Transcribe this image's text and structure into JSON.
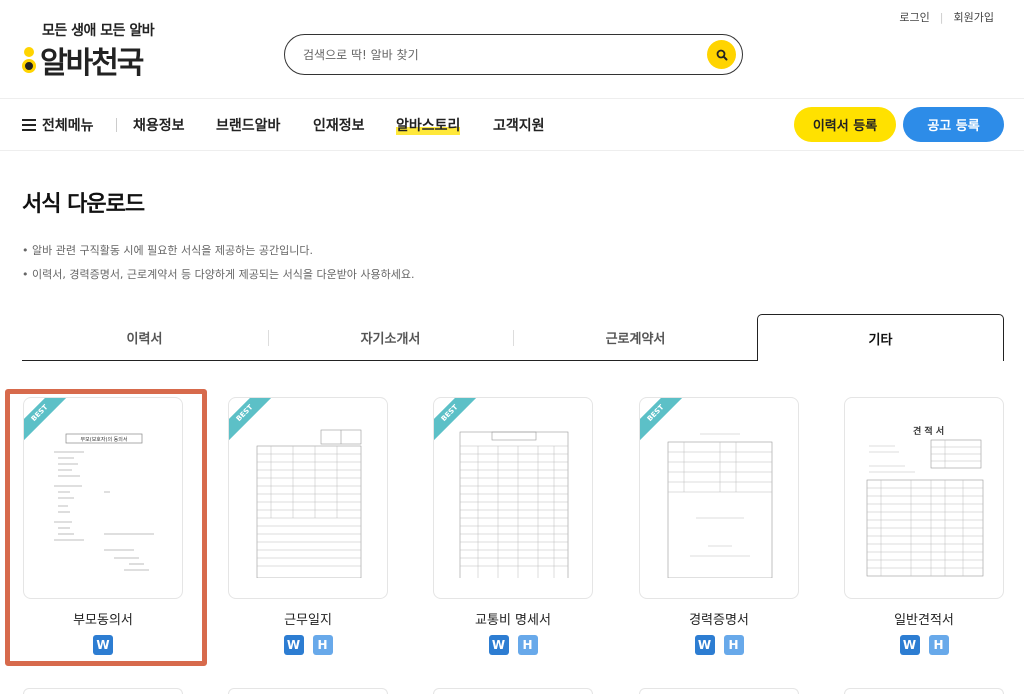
{
  "header": {
    "logo_tagline": "모든 생애 모든 알바",
    "logo_text": "알바천국",
    "search_placeholder": "검색으로 딱! 알바 찾기",
    "login": "로그인",
    "signup": "회원가입"
  },
  "nav": {
    "all_menu": "전체메뉴",
    "items": [
      "채용정보",
      "브랜드알바",
      "인재정보",
      "알바스토리",
      "고객지원"
    ],
    "resume_button": "이력서 등록",
    "post_button": "공고 등록"
  },
  "page": {
    "title": "서식 다운로드",
    "desc1": "• 알바 관련 구직활동 시에 필요한 서식을 제공하는 공간입니다.",
    "desc2": "• 이력서, 경력증명서, 근로계약서 등 다양하게 제공되는 서식을 다운받아 사용하세요."
  },
  "tabs": [
    "이력서",
    "자기소개서",
    "근로계약서",
    "기타"
  ],
  "cards": [
    {
      "name": "부모동의서",
      "best": "BEST",
      "formats": [
        "W"
      ]
    },
    {
      "name": "근무일지",
      "best": "BEST",
      "formats": [
        "W",
        "H"
      ]
    },
    {
      "name": "교통비 명세서",
      "best": "BEST",
      "formats": [
        "W",
        "H"
      ]
    },
    {
      "name": "경력증명서",
      "best": "BEST",
      "formats": [
        "W",
        "H"
      ]
    },
    {
      "name": "일반견적서",
      "best": "",
      "formats": [
        "W",
        "H"
      ]
    }
  ],
  "doc_texts": {
    "consent_title": "부모(보호자)의 동의서",
    "quote_title": "견 적 서"
  },
  "colors": {
    "brand_yellow": "#ffe100",
    "brand_blue": "#2d8ce8",
    "best_ribbon": "#5cc0c7",
    "highlight": "#d76a4c"
  }
}
